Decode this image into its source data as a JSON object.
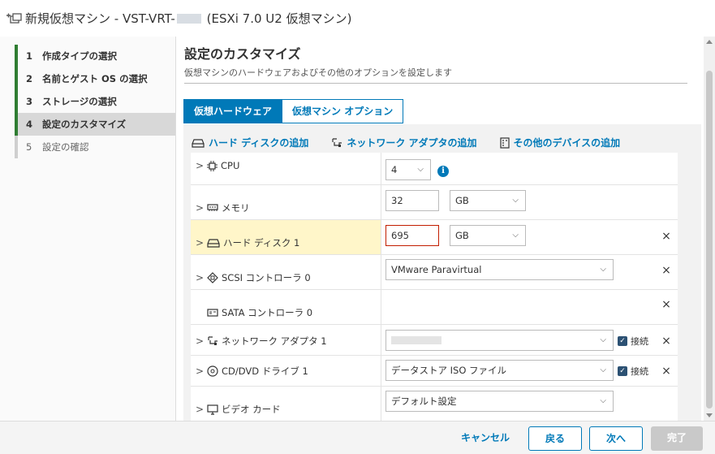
{
  "window": {
    "title_prefix": "新規仮想マシン - VST-VRT-",
    "title_suffix": " (ESXi 7.0 U2 仮想マシン)"
  },
  "steps": [
    {
      "num": "1",
      "label": "作成タイプの選択"
    },
    {
      "num": "2",
      "label": "名前とゲスト OS の選択"
    },
    {
      "num": "3",
      "label": "ストレージの選択"
    },
    {
      "num": "4",
      "label": "設定のカスタマイズ"
    },
    {
      "num": "5",
      "label": "設定の確認"
    }
  ],
  "main": {
    "title": "設定のカスタマイズ",
    "subtitle": "仮想マシンのハードウェアおよびその他のオプションを設定します"
  },
  "tabs": [
    {
      "label": "仮想ハードウェア",
      "active": true
    },
    {
      "label": "仮想マシン オプション",
      "active": false
    }
  ],
  "actions": {
    "add_disk": "ハード ディスクの追加",
    "add_network": "ネットワーク アダプタの追加",
    "add_other": "その他のデバイスの追加"
  },
  "hardware": {
    "cpu": {
      "label": "CPU",
      "value": "4",
      "info": "i"
    },
    "memory": {
      "label": "メモリ",
      "value": "32",
      "unit": "GB"
    },
    "disk": {
      "label": "ハード ディスク 1",
      "value": "695",
      "unit": "GB"
    },
    "scsi": {
      "label": "SCSI コントローラ 0",
      "value": "VMware Paravirtual"
    },
    "sata": {
      "label": "SATA コントローラ 0"
    },
    "network": {
      "label": "ネットワーク アダプタ 1",
      "connect": "接続"
    },
    "cddvd": {
      "label": "CD/DVD ドライブ 1",
      "value": "データストア ISO ファイル",
      "connect": "接続"
    },
    "video": {
      "label": "ビデオ カード",
      "value": "デフォルト設定"
    }
  },
  "footer": {
    "cancel": "キャンセル",
    "back": "戻る",
    "next": "次へ",
    "finish": "完了"
  },
  "icons": {
    "remove": "×",
    "caret": "⌄",
    "expand": "›",
    "check": "✓"
  },
  "colors": {
    "accent": "#0079b8",
    "step_done": "#2f7d32",
    "error_border": "#c21d00",
    "highlight_row": "#fff6c9"
  }
}
